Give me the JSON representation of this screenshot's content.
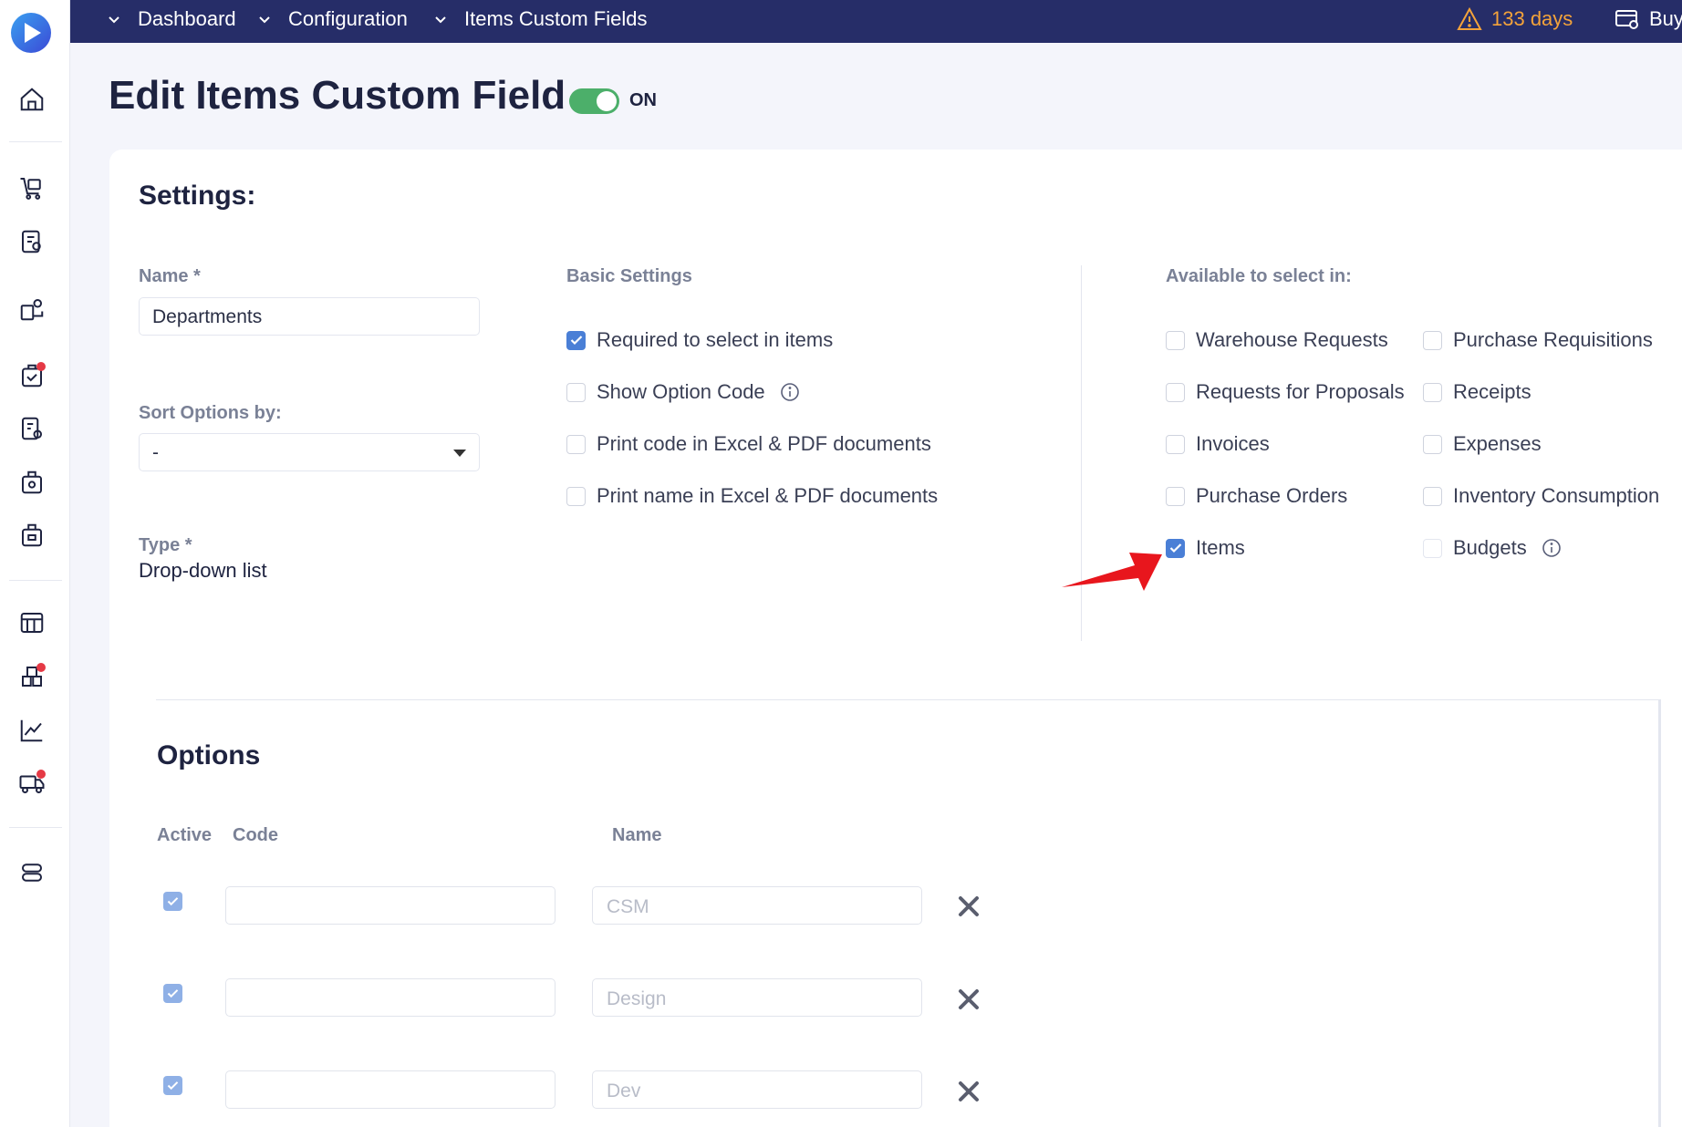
{
  "topbar": {
    "breadcrumbs": [
      "Dashboard",
      "Configuration",
      "Items Custom Fields"
    ],
    "warning_text": "133 days",
    "buy_label": "Buy"
  },
  "page": {
    "title": "Edit Items Custom Field",
    "toggle_label": "ON",
    "toggle_on": true
  },
  "settings": {
    "heading": "Settings:",
    "name_label": "Name *",
    "name_value": "Departments",
    "sort_label": "Sort Options by:",
    "sort_value": "-",
    "type_label": "Type *",
    "type_value": "Drop-down list",
    "basic_heading": "Basic Settings",
    "basic": [
      {
        "label": "Required to select in items",
        "checked": true
      },
      {
        "label": "Show Option Code",
        "checked": false
      },
      {
        "label": "Print code in Excel & PDF documents",
        "checked": false
      },
      {
        "label": "Print name in Excel & PDF documents",
        "checked": false
      }
    ],
    "available_heading": "Available to select in:",
    "available_left": [
      {
        "label": "Warehouse Requests",
        "checked": false
      },
      {
        "label": "Requests for Proposals",
        "checked": false
      },
      {
        "label": "Invoices",
        "checked": false
      },
      {
        "label": "Purchase Orders",
        "checked": false
      },
      {
        "label": "Items",
        "checked": true
      }
    ],
    "available_right": [
      {
        "label": "Purchase Requisitions",
        "checked": false
      },
      {
        "label": "Receipts",
        "checked": false
      },
      {
        "label": "Expenses",
        "checked": false
      },
      {
        "label": "Inventory Consumption",
        "checked": false
      },
      {
        "label": "Budgets",
        "checked": false
      }
    ]
  },
  "options": {
    "heading": "Options",
    "col_active": "Active",
    "col_code": "Code",
    "col_name": "Name",
    "rows": [
      {
        "active": true,
        "code": "",
        "name": "CSM"
      },
      {
        "active": true,
        "code": "",
        "name": "Design"
      },
      {
        "active": true,
        "code": "",
        "name": "Dev"
      }
    ]
  },
  "colors": {
    "topbar": "#262d68",
    "accent": "#4a7fd6",
    "toggle": "#4caf6a",
    "warning": "#f4a33a",
    "arrow": "#e8161d"
  }
}
